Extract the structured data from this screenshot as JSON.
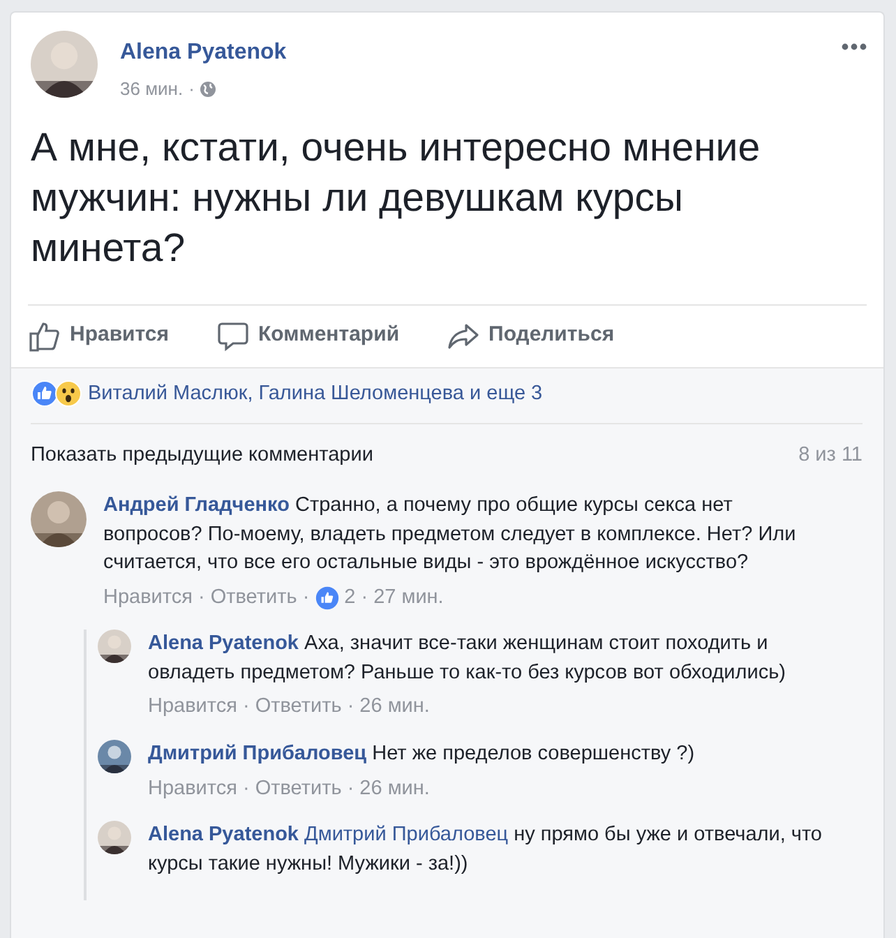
{
  "separator": "·",
  "post": {
    "author": "Alena Pyatenok",
    "time": "36 мин.",
    "text": "А мне, кстати, очень интересно мнение мужчин: нужны ли девушкам курсы минета?"
  },
  "actions": [
    "Нравится",
    "Комментарий",
    "Поделиться"
  ],
  "reactions": {
    "text": "Виталий Маслюк, Галина Шеломенцева и еще 3"
  },
  "show_previous": {
    "label": "Показать предыдущие комментарии",
    "count": "8 из 11"
  },
  "comments": [
    {
      "kind": "comment",
      "author": "Андрей Гладченко",
      "text": "Странно, а почему про общие курсы секса нет вопросов? По-моему, владеть предметом следует в комплексе. Нет? Или считается, что все его остальные виды - это врождённое искусство?",
      "like": "Нравится",
      "reply": "Ответить",
      "likes": "2",
      "time": "27 мин."
    },
    {
      "kind": "reply",
      "author": "Alena Pyatenok",
      "text": "Аха, значит все-таки женщинам стоит походить и овладеть предметом? Раньше то как-то без курсов вот обходились)",
      "like": "Нравится",
      "reply": "Ответить",
      "time": "26 мин."
    },
    {
      "kind": "reply",
      "author": "Дмитрий Прибаловец",
      "text": "Нет же пределов совершенству ?)",
      "like": "Нравится",
      "reply": "Ответить",
      "time": "26 мин."
    },
    {
      "kind": "reply",
      "author": "Alena Pyatenok",
      "mention": "Дмитрий Прибаловец",
      "text": "ну прямо бы уже и отвечали, что курсы такие нужны! Мужики - за!))"
    }
  ]
}
